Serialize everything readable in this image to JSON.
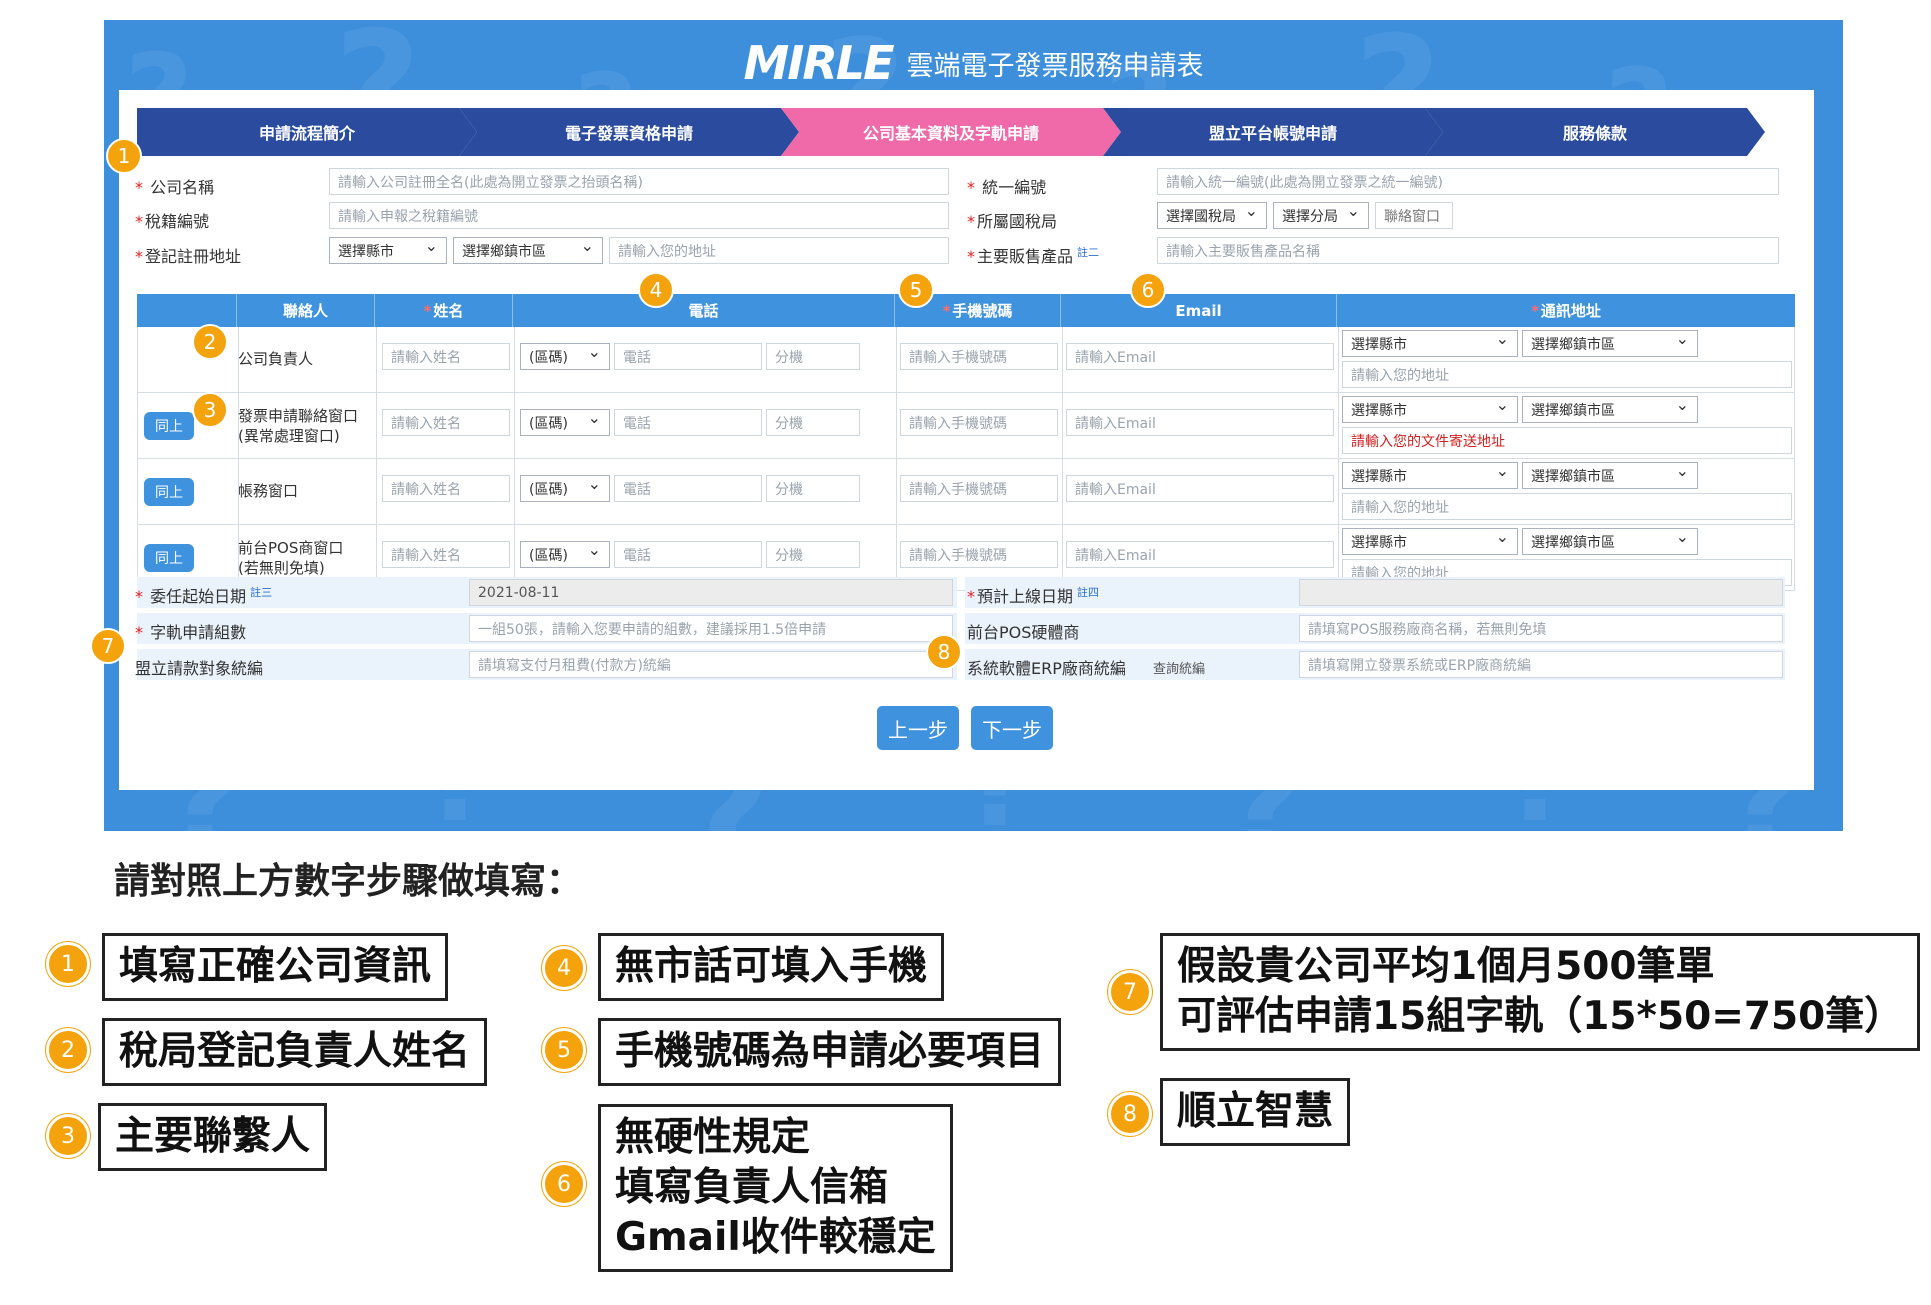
{
  "brand": {
    "logo": "MIRLE",
    "title": "雲端電子發票服務申請表"
  },
  "steps": [
    {
      "label": "申請流程簡介",
      "active": false
    },
    {
      "label": "電子發票資格申請",
      "active": false
    },
    {
      "label": "公司基本資料及字軌申請",
      "active": true
    },
    {
      "label": "盟立平台帳號申請",
      "active": false
    },
    {
      "label": "服務條款",
      "active": false
    }
  ],
  "colors": {
    "step": "#2b4c9e",
    "step_active": "#f06aa9",
    "frame": "#3d8fdc",
    "header": "#3f92de",
    "badge": "#f4a30d",
    "required": "#e02020"
  },
  "company": {
    "name_label": "公司名稱",
    "name_placeholder": "請輸入公司註冊全名(此處為開立發票之抬頭名稱)",
    "tax_no_label": "統一編號",
    "tax_no_placeholder": "請輸入統一編號(此處為開立發票之統一編號)",
    "tax_reg_label": "稅籍編號",
    "tax_reg_placeholder": "請輸入申報之稅籍編號",
    "tax_office_label": "所屬國稅局",
    "tax_office_select": "選擇國稅局",
    "tax_branch_select": "選擇分局",
    "tax_window": "聯絡窗口",
    "address_label": "登記註冊地址",
    "city_select": "選擇縣市",
    "district_select": "選擇鄉鎮市區",
    "address_placeholder": "請輸入您的地址",
    "product_label": "主要販售產品",
    "product_note": "註二",
    "product_placeholder": "請輸入主要販售產品名稱"
  },
  "table": {
    "headers": [
      "聯絡人",
      "姓名",
      "電話",
      "手機號碼",
      "Email",
      "通訊地址"
    ],
    "rows": [
      {
        "label": "公司負責人",
        "has_same": false
      },
      {
        "label": "發票申請聯絡窗口\n(異常處理窗口)",
        "has_same": true,
        "address_placeholder": "請輸入您的文件寄送地址"
      },
      {
        "label": "帳務窗口",
        "has_same": true
      },
      {
        "label": "前台POS商窗口\n(若無則免填)",
        "has_same": true
      }
    ],
    "same_label": "同上",
    "name_placeholder": "請輸入姓名",
    "area_code": "(區碼)",
    "phone_placeholder": "電話",
    "ext_placeholder": "分機",
    "mobile_placeholder": "請輸入手機號碼",
    "email_placeholder": "請輸入Email",
    "city_select": "選擇縣市",
    "district_select": "選擇鄉鎮市區",
    "address_placeholder": "請輸入您的地址"
  },
  "extra": {
    "start_date_label": "委任起始日期",
    "start_date_note": "註三",
    "start_date_value": "2021-08-11",
    "golive_label": "預計上線日期",
    "golive_note": "註四",
    "track_label": "字軌申請組數",
    "track_placeholder": "一組50張，請輸入您要申請的組數，建議採用1.5倍申請",
    "pos_label": "前台POS硬體商",
    "pos_placeholder": "請填寫POS服務廠商名稱，若無則免填",
    "billing_label": "盟立請款對象統編",
    "billing_placeholder": "請填寫支付月租費(付款方)統編",
    "erp_label": "系統軟體ERP廠商統編",
    "erp_lookup": "查詢統編",
    "erp_placeholder": "請填寫開立發票系統或ERP廠商統編"
  },
  "nav": {
    "prev": "上一步",
    "next": "下一步"
  },
  "legend": {
    "heading": "請對照上方數字步驟做填寫：",
    "items": [
      {
        "n": "1",
        "text": "填寫正確公司資訊"
      },
      {
        "n": "2",
        "text": "稅局登記負責人姓名"
      },
      {
        "n": "3",
        "text": "主要聯繫人"
      },
      {
        "n": "4",
        "text": "無市話可填入手機"
      },
      {
        "n": "5",
        "text": "手機號碼為申請必要項目"
      },
      {
        "n": "6",
        "text": "無硬性規定\n填寫負責人信箱\nGmail收件較穩定"
      },
      {
        "n": "7",
        "text": "假設貴公司平均1個月500筆單\n可評估申請15組字軌（15*50=750筆）"
      },
      {
        "n": "8",
        "text": "順立智慧"
      }
    ]
  }
}
